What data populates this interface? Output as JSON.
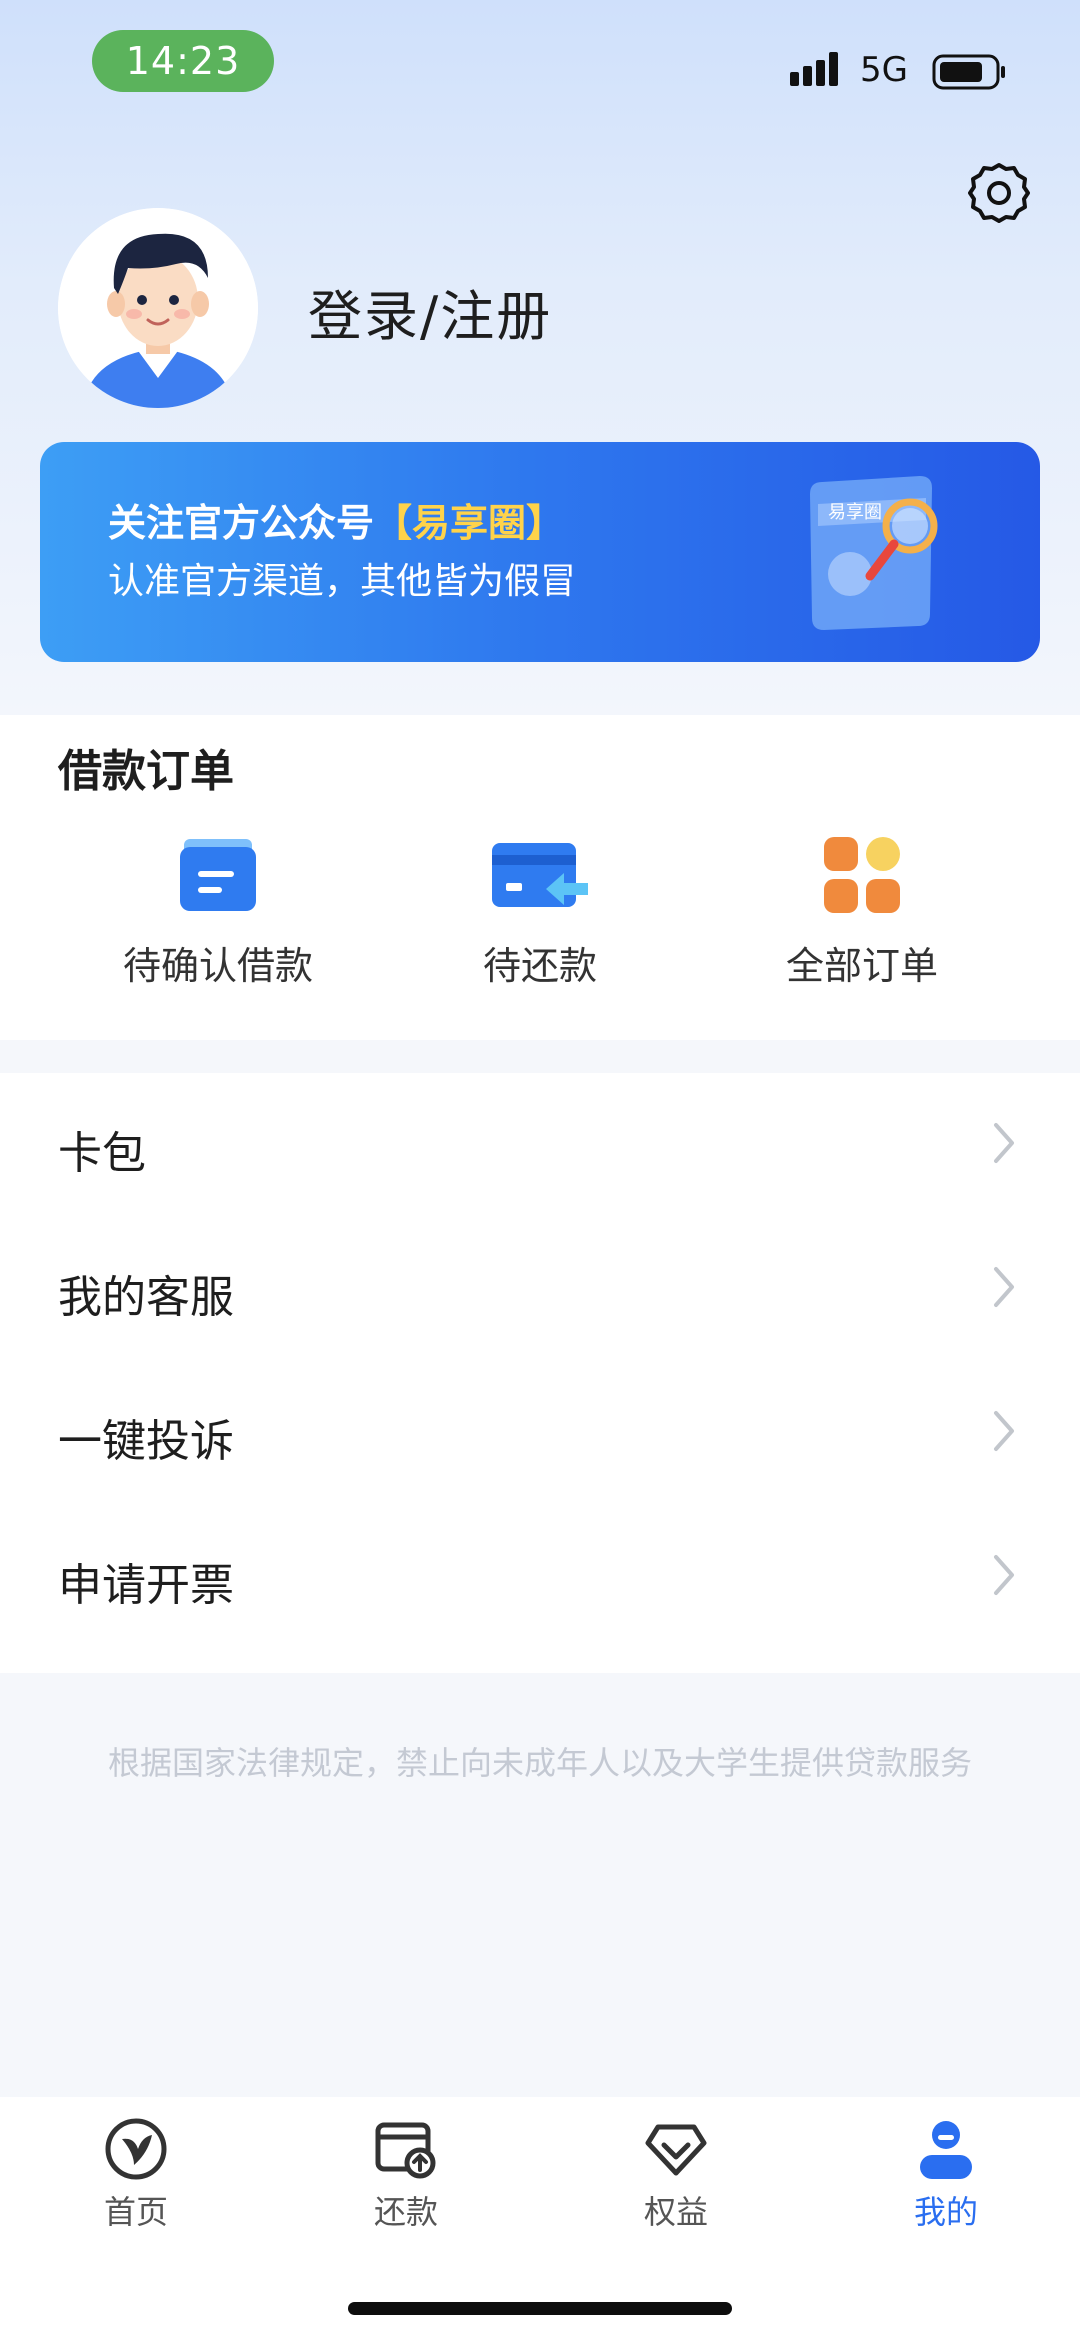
{
  "status_bar": {
    "time": "14:23",
    "network": "5G"
  },
  "profile": {
    "login_label": "登录/注册"
  },
  "banner": {
    "line1_prefix": "关注官方公众号",
    "line1_highlight": "【易享圈】",
    "line2": "认准官方渠道，其他皆为假冒",
    "art_label": "易享圈"
  },
  "orders": {
    "title": "借款订单",
    "items": [
      {
        "label": "待确认借款",
        "icon": "pending-loan-icon"
      },
      {
        "label": "待还款",
        "icon": "repay-card-icon"
      },
      {
        "label": "全部订单",
        "icon": "all-orders-icon"
      }
    ]
  },
  "menu": {
    "items": [
      {
        "label": "卡包"
      },
      {
        "label": "我的客服"
      },
      {
        "label": "一键投诉"
      },
      {
        "label": "申请开票"
      }
    ]
  },
  "disclaimer": "根据国家法律规定，禁止向未成年人以及大学生提供贷款服务",
  "tabbar": {
    "tabs": [
      {
        "label": "首页",
        "icon": "home-logo-icon"
      },
      {
        "label": "还款",
        "icon": "repay-icon"
      },
      {
        "label": "权益",
        "icon": "benefits-diamond-icon"
      },
      {
        "label": "我的",
        "icon": "profile-icon",
        "active": true
      }
    ]
  },
  "colors": {
    "accent": "#2a6ef0",
    "banner_highlight": "#ffd34a",
    "time_pill": "#5bb35c"
  }
}
